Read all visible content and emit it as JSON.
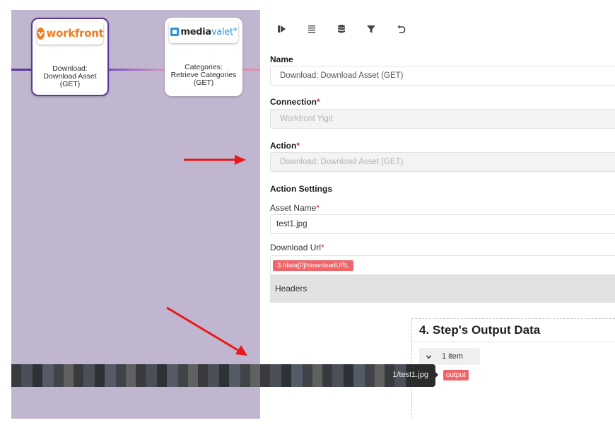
{
  "canvas": {
    "background": "#c1b6cf",
    "nodes": [
      {
        "logo_icon": "workfront-logo-icon",
        "logo_text": "workfront",
        "label": "Download:\nDownload Asset\n(GET)",
        "selected": true
      },
      {
        "logo_icon": "mediavalet-logo-icon",
        "logo_text_a": "media",
        "logo_text_b": "valet",
        "logo_mark": "®",
        "label": "Categories:\nRetrieve Categories\n(GET)",
        "selected": false
      }
    ]
  },
  "toolbar": {
    "icons": [
      "run-step-icon",
      "list-icon",
      "database-icon",
      "filter-icon",
      "undo-icon"
    ]
  },
  "form": {
    "name_label": "Name",
    "name_value": "Download: Download Asset (GET)",
    "connection_label": "Connection",
    "connection_value": "Workfront Yigit",
    "action_label": "Action",
    "action_value": "Download: Download Asset (GET)",
    "required_mark": "*",
    "action_settings_label": "Action Settings",
    "asset_name_label": "Asset Name",
    "asset_name_value": "test1.jpg",
    "download_url_label": "Download Url",
    "download_url_pill": "3./data[0]/downloadURL",
    "headers_label": "Headers"
  },
  "output": {
    "title": "4. Step's Output Data",
    "items_label": "1 item",
    "data_bar_text": "1/test1.jpg",
    "output_pill": "output"
  },
  "colors": {
    "accent_purple": "#5b3c9a",
    "pill_red": "#ef6569",
    "required_red": "#d9262d",
    "annotation_arrow": "#e8191a"
  }
}
